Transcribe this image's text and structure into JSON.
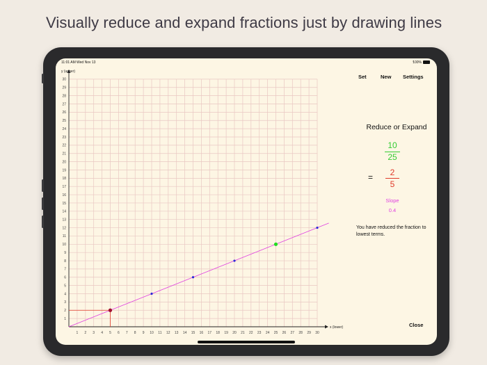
{
  "headline": "Visually reduce and expand fractions just by drawing lines",
  "status_bar": {
    "time": "11:01 AM",
    "date": "Wed Nov 13",
    "battery": "100%"
  },
  "toolbar": {
    "set_label": "Set",
    "new_label": "New",
    "settings_label": "Settings"
  },
  "panel": {
    "title": "Reduce or Expand",
    "original_fraction": {
      "numerator": "10",
      "denominator": "25"
    },
    "equals": "=",
    "reduced_fraction": {
      "numerator": "2",
      "denominator": "5"
    },
    "slope_label": "Slope",
    "slope_value": "0.4",
    "message": "You have reduced the fraction to lowest terms.",
    "close_label": "Close"
  },
  "colors": {
    "green": "#33cc33",
    "red": "#e03a2a",
    "magenta": "#e040e0",
    "grid": "#e9c7c2",
    "point_blue": "#2a2ad8",
    "point_red": "#a01030",
    "point_green": "#22dd22",
    "paper": "#fdf6e4"
  },
  "chart_data": {
    "type": "scatter",
    "xlabel": "x (lower)",
    "ylabel": "y (upper)",
    "xlim": [
      0,
      30
    ],
    "ylim": [
      0,
      30
    ],
    "x_ticks": [
      1,
      2,
      3,
      4,
      5,
      6,
      7,
      8,
      9,
      10,
      11,
      12,
      13,
      14,
      15,
      16,
      17,
      18,
      19,
      20,
      21,
      22,
      23,
      24,
      25,
      26,
      27,
      28,
      29,
      30
    ],
    "y_ticks": [
      1,
      2,
      3,
      4,
      5,
      6,
      7,
      8,
      9,
      10,
      11,
      12,
      13,
      14,
      15,
      16,
      17,
      18,
      19,
      20,
      21,
      22,
      23,
      24,
      25,
      26,
      27,
      28,
      29,
      30
    ],
    "grid": true,
    "line": {
      "slope": 0.4,
      "x_start": 0,
      "x_end": 31.4
    },
    "points": [
      {
        "x": 5,
        "y": 2,
        "color": "#a01030",
        "highlighted": true
      },
      {
        "x": 10,
        "y": 4,
        "color": "#2a2ad8"
      },
      {
        "x": 15,
        "y": 6,
        "color": "#2a2ad8"
      },
      {
        "x": 20,
        "y": 8,
        "color": "#2a2ad8"
      },
      {
        "x": 25,
        "y": 10,
        "color": "#22dd22",
        "highlighted": true
      },
      {
        "x": 30,
        "y": 12,
        "color": "#2a2ad8"
      }
    ],
    "guide_point": {
      "x": 5,
      "y": 2
    }
  }
}
